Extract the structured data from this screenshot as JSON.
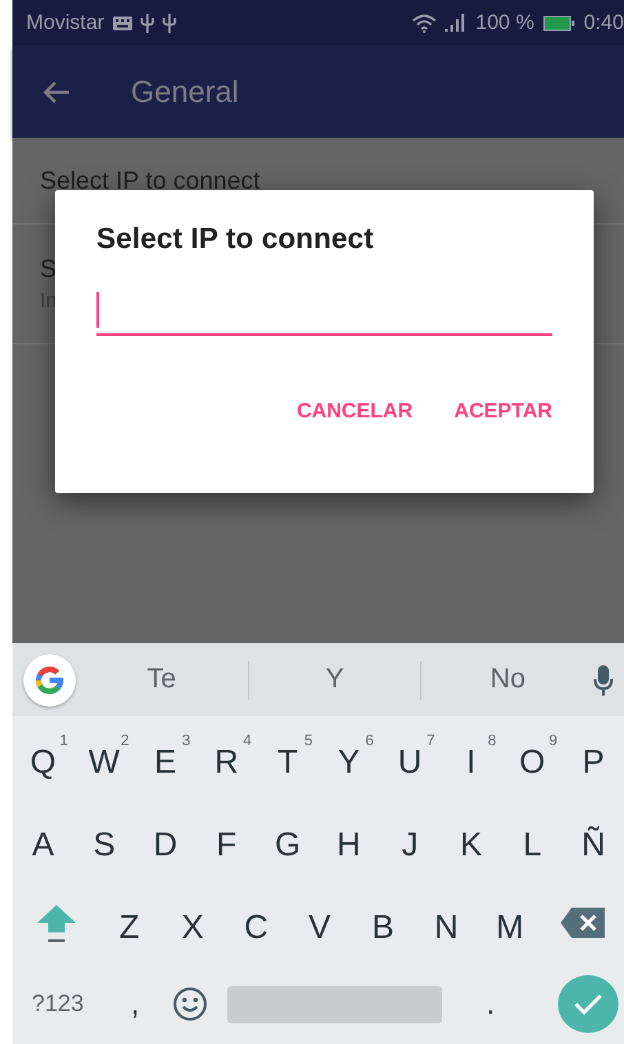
{
  "status_bar": {
    "carrier": "Movistar",
    "battery": "100 %",
    "time": "0:40"
  },
  "app_bar": {
    "title": "General"
  },
  "settings": [
    {
      "title": "Select IP to connect"
    },
    {
      "title": "S",
      "subtitle": "In"
    }
  ],
  "dialog": {
    "title": "Select IP to connect",
    "buttons": [
      "CANCELAR",
      "ACEPTAR"
    ]
  },
  "keyboard": {
    "suggestions": [
      "Te",
      "Y",
      "No"
    ],
    "rows": [
      [
        {
          "label": "Q",
          "hint": "1"
        },
        {
          "label": "W",
          "hint": "2"
        },
        {
          "label": "E",
          "hint": "3"
        },
        {
          "label": "R",
          "hint": "4"
        },
        {
          "label": "T",
          "hint": "5"
        },
        {
          "label": "Y",
          "hint": "6"
        },
        {
          "label": "U",
          "hint": "7"
        },
        {
          "label": "I",
          "hint": "8"
        },
        {
          "label": "O",
          "hint": "9"
        },
        {
          "label": "P"
        }
      ],
      [
        {
          "label": "A"
        },
        {
          "label": "S"
        },
        {
          "label": "D"
        },
        {
          "label": "F"
        },
        {
          "label": "G"
        },
        {
          "label": "H"
        },
        {
          "label": "J"
        },
        {
          "label": "K"
        },
        {
          "label": "L"
        },
        {
          "label": "Ñ"
        }
      ],
      [
        {
          "label": "Z"
        },
        {
          "label": "X"
        },
        {
          "label": "C"
        },
        {
          "label": "V"
        },
        {
          "label": "B"
        },
        {
          "label": "N"
        },
        {
          "label": "M"
        }
      ]
    ],
    "symbols_key": "?123",
    "comma_key": ",",
    "period_key": "."
  }
}
